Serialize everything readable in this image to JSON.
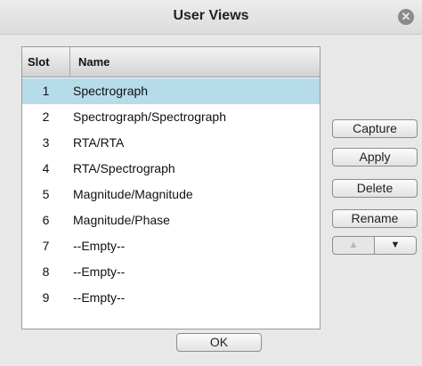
{
  "window": {
    "title": "User Views",
    "close_glyph": "✕"
  },
  "table": {
    "headers": {
      "slot": "Slot",
      "name": "Name"
    },
    "rows": [
      {
        "slot": "1",
        "name": "Spectrograph",
        "selected": true
      },
      {
        "slot": "2",
        "name": "Spectrograph/Spectrograph"
      },
      {
        "slot": "3",
        "name": "RTA/RTA"
      },
      {
        "slot": "4",
        "name": "RTA/Spectrograph"
      },
      {
        "slot": "5",
        "name": "Magnitude/Magnitude"
      },
      {
        "slot": "6",
        "name": "Magnitude/Phase"
      },
      {
        "slot": "7",
        "name": "--Empty--"
      },
      {
        "slot": "8",
        "name": "--Empty--"
      },
      {
        "slot": "9",
        "name": "--Empty--"
      }
    ]
  },
  "actions": {
    "capture": "Capture",
    "apply": "Apply",
    "delete": "Delete",
    "rename": "Rename",
    "move_up_glyph": "▲",
    "move_down_glyph": "▼"
  },
  "footer": {
    "ok": "OK"
  },
  "colors": {
    "selection": "#b6dbe9",
    "dialog_bg": "#e8e8e8"
  }
}
